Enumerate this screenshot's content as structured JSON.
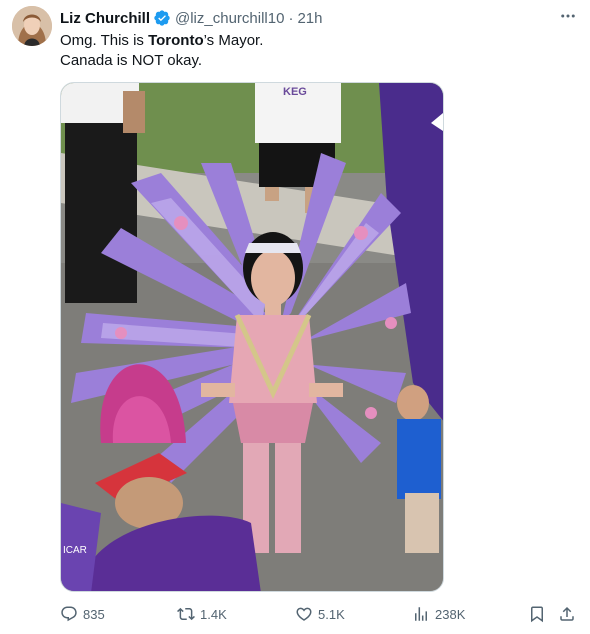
{
  "author": {
    "name": "Liz Churchill",
    "handle": "@liz_churchill10",
    "separator": "·",
    "time": "21h"
  },
  "tweet": {
    "line1_before": "Omg. This is ",
    "line1_bold": "Toronto",
    "line1_after": "’s Mayor.",
    "line2": "Canada is NOT okay."
  },
  "media": {
    "shirt_text": "KEG",
    "sleeve_text": "ICAR"
  },
  "actions": {
    "replies": "835",
    "reposts": "1.4K",
    "likes": "5.1K",
    "views": "238K"
  },
  "colors": {
    "verified": "#1d9bf0",
    "icon": "#536471",
    "feathers": "#9b7fd9"
  },
  "icons": [
    "verified-badge-icon",
    "more-icon",
    "reply-icon",
    "repost-icon",
    "like-icon",
    "views-icon",
    "bookmark-icon",
    "share-icon"
  ]
}
